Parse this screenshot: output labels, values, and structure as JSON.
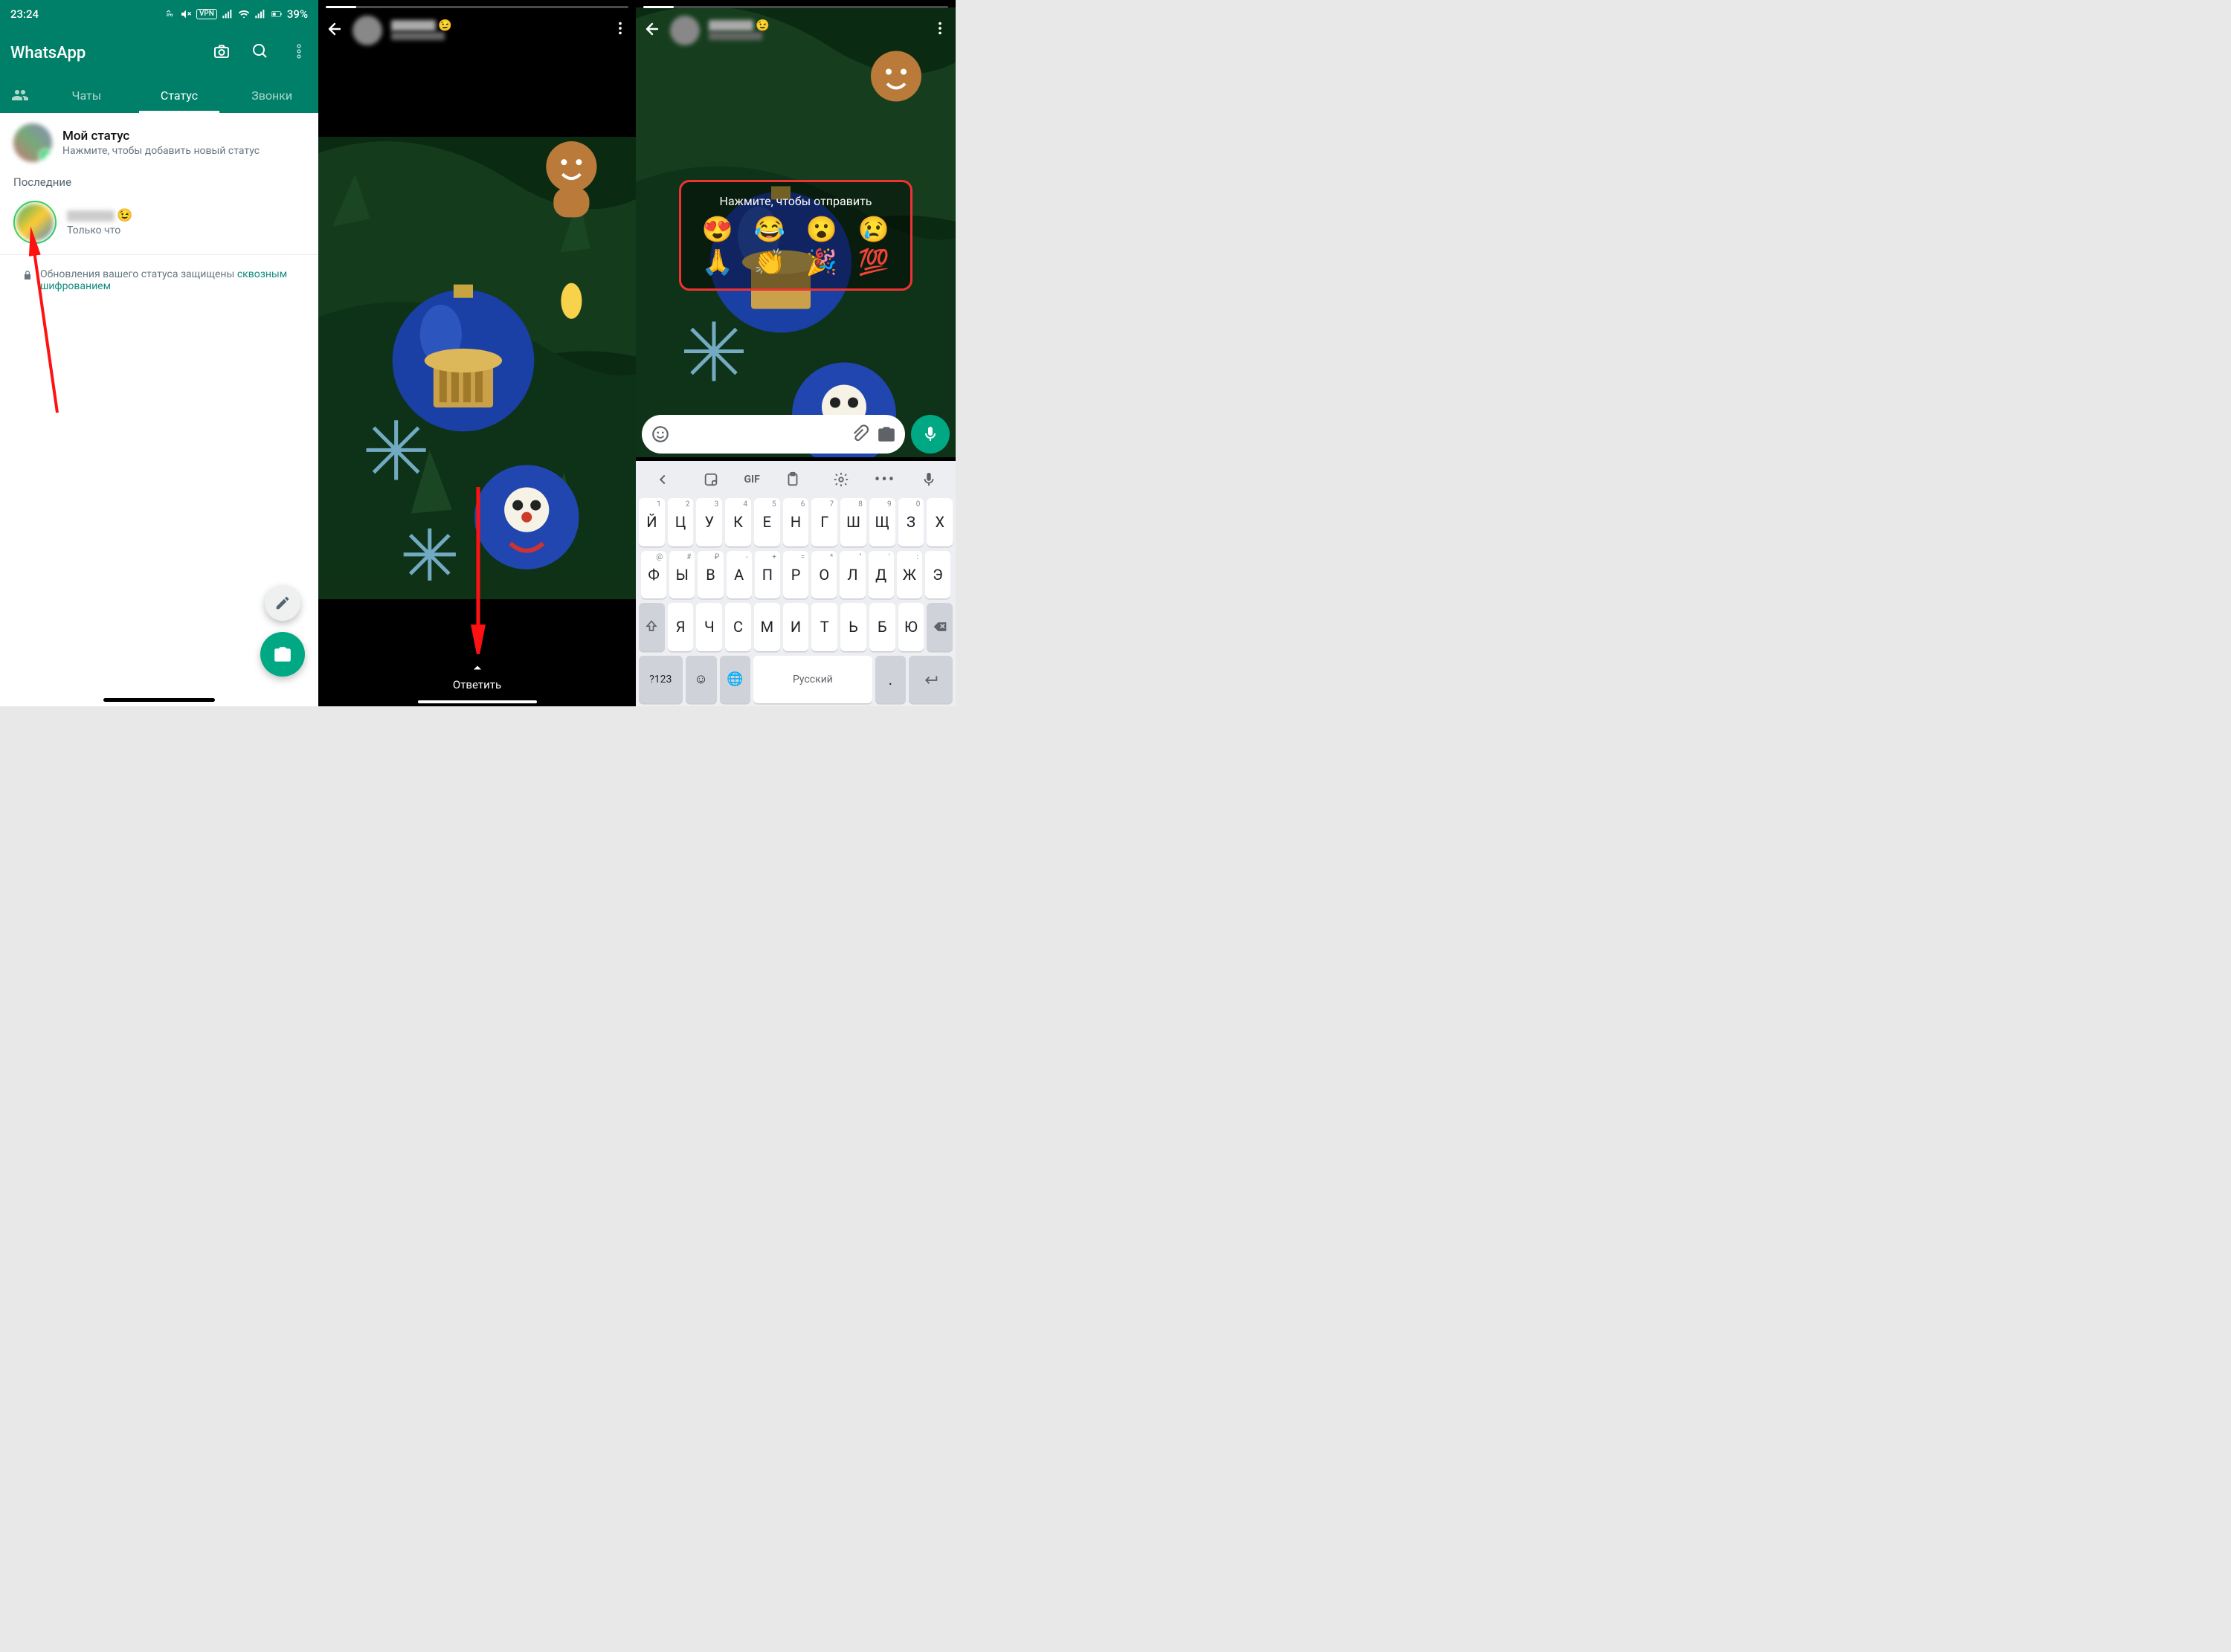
{
  "screen1": {
    "statusbar_time": "23:24",
    "battery_text": "39%",
    "app_title": "WhatsApp",
    "tabs": {
      "chats": "Чаты",
      "status": "Статус",
      "calls": "Звонки"
    },
    "my_status_title": "Мой статус",
    "my_status_sub": "Нажмите, чтобы добавить новый статус",
    "recent_label": "Последние",
    "recent_time": "Только что",
    "encryption_text": "Обновления вашего статуса защищены ",
    "encryption_link": "сквозным шифрованием"
  },
  "screen2": {
    "reply_label": "Ответить"
  },
  "screen3": {
    "reaction_hint": "Нажмите, чтобы отправить",
    "emojis_row1": [
      "😍",
      "😂",
      "😮",
      "😢"
    ],
    "emojis_row2": [
      "🙏",
      "👏",
      "🎉",
      "💯"
    ],
    "keyboard": {
      "gif_label": "GIF",
      "numkey_label": "?123",
      "space_label": "Русский",
      "row1": [
        {
          "ch": "Й",
          "h": "1"
        },
        {
          "ch": "Ц",
          "h": "2"
        },
        {
          "ch": "У",
          "h": "3"
        },
        {
          "ch": "К",
          "h": "4"
        },
        {
          "ch": "Е",
          "h": "5"
        },
        {
          "ch": "Н",
          "h": "6"
        },
        {
          "ch": "Г",
          "h": "7"
        },
        {
          "ch": "Ш",
          "h": "8"
        },
        {
          "ch": "Щ",
          "h": "9"
        },
        {
          "ch": "З",
          "h": "0"
        },
        {
          "ch": "Х",
          "h": ""
        }
      ],
      "row2": [
        {
          "ch": "Ф",
          "h": "@"
        },
        {
          "ch": "Ы",
          "h": "#"
        },
        {
          "ch": "В",
          "h": "₽"
        },
        {
          "ch": "А",
          "h": "-"
        },
        {
          "ch": "П",
          "h": "+"
        },
        {
          "ch": "Р",
          "h": "="
        },
        {
          "ch": "О",
          "h": "*"
        },
        {
          "ch": "Л",
          "h": "\""
        },
        {
          "ch": "Д",
          "h": "'"
        },
        {
          "ch": "Ж",
          "h": ":"
        },
        {
          "ch": "Э",
          "h": ""
        }
      ],
      "row3": [
        {
          "ch": "Я",
          "h": ""
        },
        {
          "ch": "Ч",
          "h": ""
        },
        {
          "ch": "С",
          "h": ""
        },
        {
          "ch": "М",
          "h": ""
        },
        {
          "ch": "И",
          "h": ""
        },
        {
          "ch": "Т",
          "h": ""
        },
        {
          "ch": "Ь",
          "h": ""
        },
        {
          "ch": "Б",
          "h": ""
        },
        {
          "ch": "Ю",
          "h": ""
        }
      ]
    }
  }
}
